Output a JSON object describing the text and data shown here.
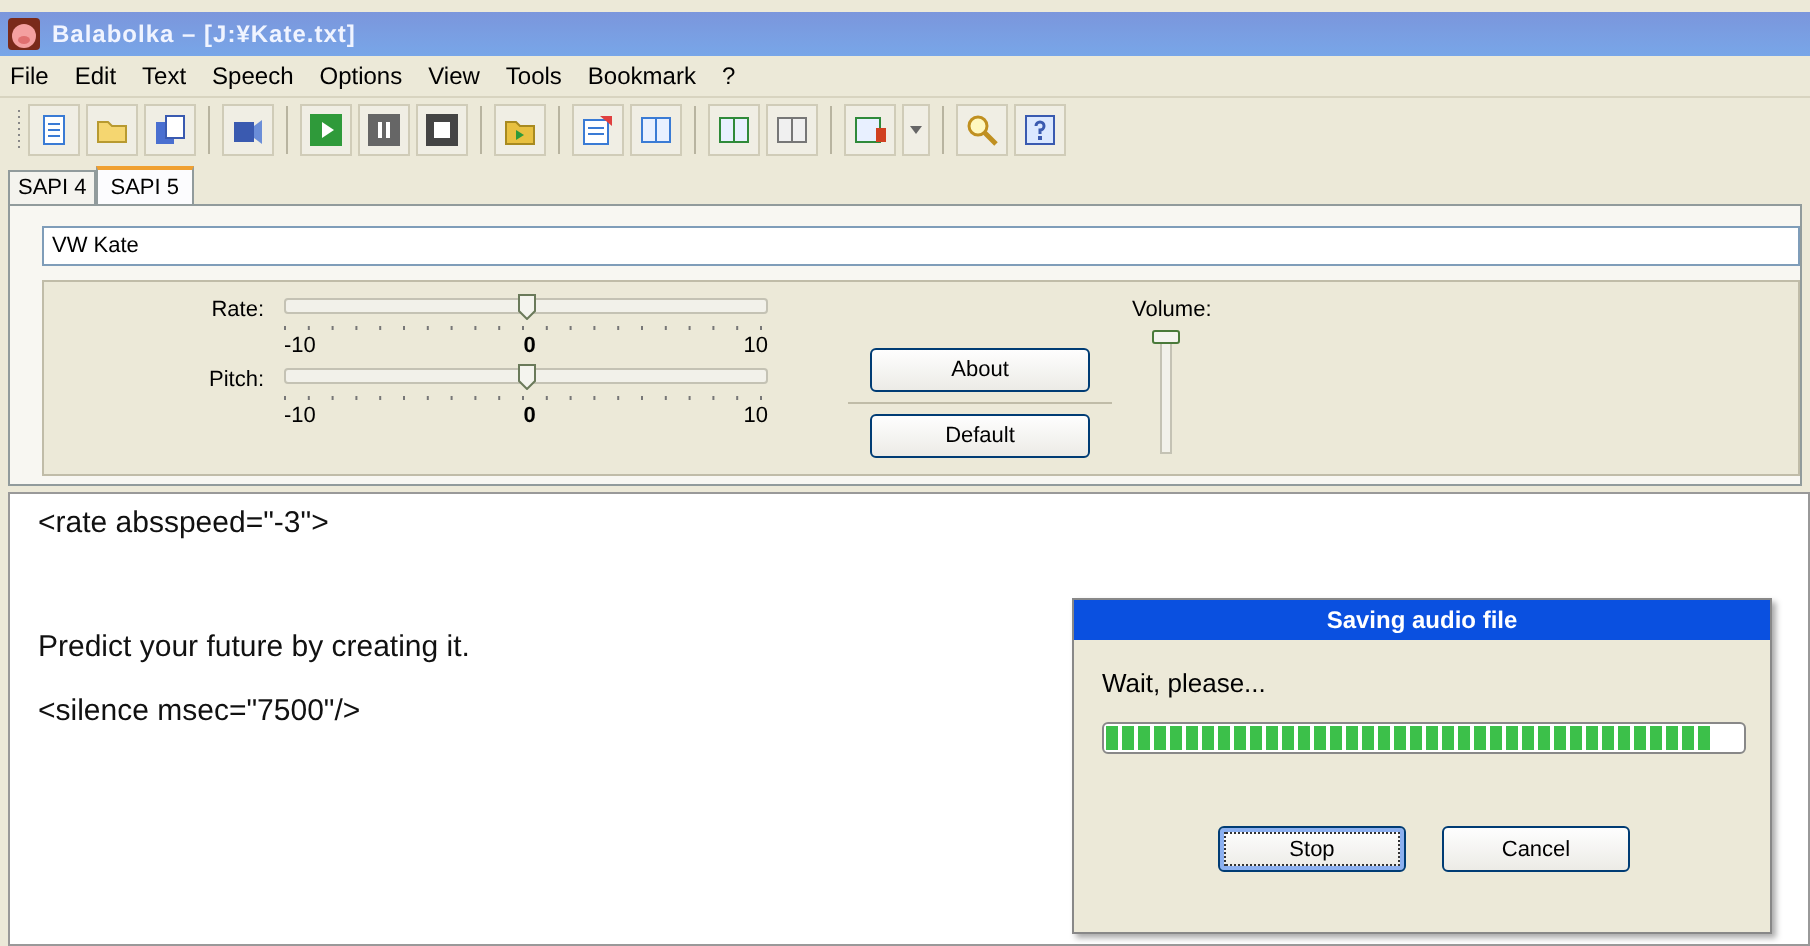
{
  "window": {
    "title": "Balabolka – [J:¥Kate.txt]"
  },
  "menu": [
    {
      "label": "File"
    },
    {
      "label": "Edit"
    },
    {
      "label": "Text"
    },
    {
      "label": "Speech"
    },
    {
      "label": "Options"
    },
    {
      "label": "View"
    },
    {
      "label": "Tools"
    },
    {
      "label": "Bookmark"
    },
    {
      "label": "?"
    }
  ],
  "tabs": [
    {
      "label": "SAPI 4",
      "selected": false
    },
    {
      "label": "SAPI 5",
      "selected": true
    }
  ],
  "voice": {
    "value": "VW Kate"
  },
  "sliders": [
    {
      "label": "Rate:",
      "level": 0.5,
      "min": "-10",
      "mid": "0",
      "max": "10"
    },
    {
      "label": "Pitch:",
      "level": 0.5,
      "min": "-10",
      "mid": "0",
      "max": "10"
    }
  ],
  "buttons": [
    "About",
    "Default"
  ],
  "volume": {
    "label": "Volume:",
    "level": 1
  },
  "editor": {
    "lines": [
      "<rate absspeed=\"-3\">",
      "Predict your future by creating it.",
      "<silence msec=\"7500\"/>"
    ]
  },
  "dialog": {
    "title": "Saving audio file",
    "message": "Wait, please...",
    "progress": {
      "level": 0.95
    },
    "buttons": [
      {
        "label": "Stop",
        "focused": true
      },
      {
        "label": "Cancel",
        "focused": false
      }
    ]
  }
}
